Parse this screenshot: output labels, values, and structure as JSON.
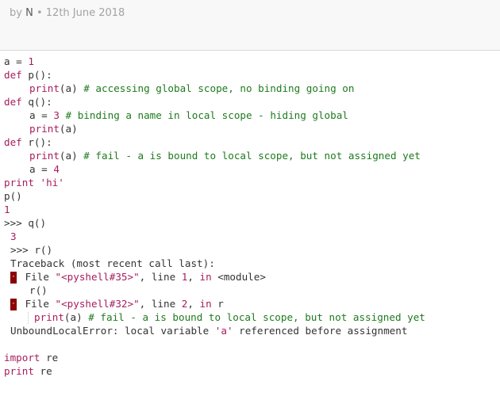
{
  "meta": {
    "prefix": "by",
    "author": "N",
    "separator": "•",
    "date": "12th June 2018"
  },
  "code": {
    "l1": {
      "a": "a",
      "eq": " = ",
      "n": "1"
    },
    "l2": {
      "kw": "def",
      "rest": " p():"
    },
    "l3": {
      "fn": "print",
      "rest": "(a) ",
      "cmt": "# accessing global scope, no binding going on"
    },
    "l4": {
      "kw": "def",
      "rest": " q():"
    },
    "l5": {
      "a": "a",
      "eq": " = ",
      "n": "3",
      "sp": " ",
      "cmt": "# binding a name in local scope - hiding global"
    },
    "l6": {
      "fn": "print",
      "rest": "(a)"
    },
    "l7": {
      "kw": "def",
      "rest": " r():"
    },
    "l8": {
      "fn": "print",
      "rest": "(a) ",
      "cmt": "# fail - a is bound to local scope, but not assigned yet"
    },
    "l9": {
      "a": "a",
      "eq": " = ",
      "n": "4"
    },
    "l10": {
      "kw": "print",
      "sp": " ",
      "s": "'hi'"
    },
    "l11": {
      "text": "p()"
    },
    "l12": {
      "n": "1"
    },
    "l13": {
      "prompt": ">>> ",
      "text": "q()"
    },
    "l14": {
      "n": "3"
    },
    "l15": {
      "prompt": ">>> ",
      "text": "r()"
    },
    "l16": {
      "text": "Traceback (most recent call last):"
    },
    "l17": {
      "mark": "·",
      "a": " File ",
      "s": "\"<pyshell#35>\"",
      "b": ", line ",
      "n": "1",
      "c": ", ",
      "kw": "in",
      "d": " <module>"
    },
    "l18": {
      "text": "r()"
    },
    "l19": {
      "mark": "·",
      "a": " File ",
      "s": "\"<pyshell#32>\"",
      "b": ", line ",
      "n": "2",
      "c": ", ",
      "kw": "in",
      "d": " r"
    },
    "l20": {
      "fn": "print",
      "rest": "(a) ",
      "cmt": "# fail - a is bound to local scope, but not assigned yet"
    },
    "l21": {
      "a": "UnboundLocalError: local variable ",
      "s": "'a'",
      "b": " referenced before assignment"
    },
    "l23": {
      "kw": "import",
      "rest": " re"
    },
    "l24": {
      "kw": "print",
      "rest": " re"
    },
    "colors": {
      "keyword": "#a71d5d",
      "comment": "#1e7a1e",
      "error_marker": "#8b0000",
      "meta_text": "#a3a3a3"
    }
  }
}
